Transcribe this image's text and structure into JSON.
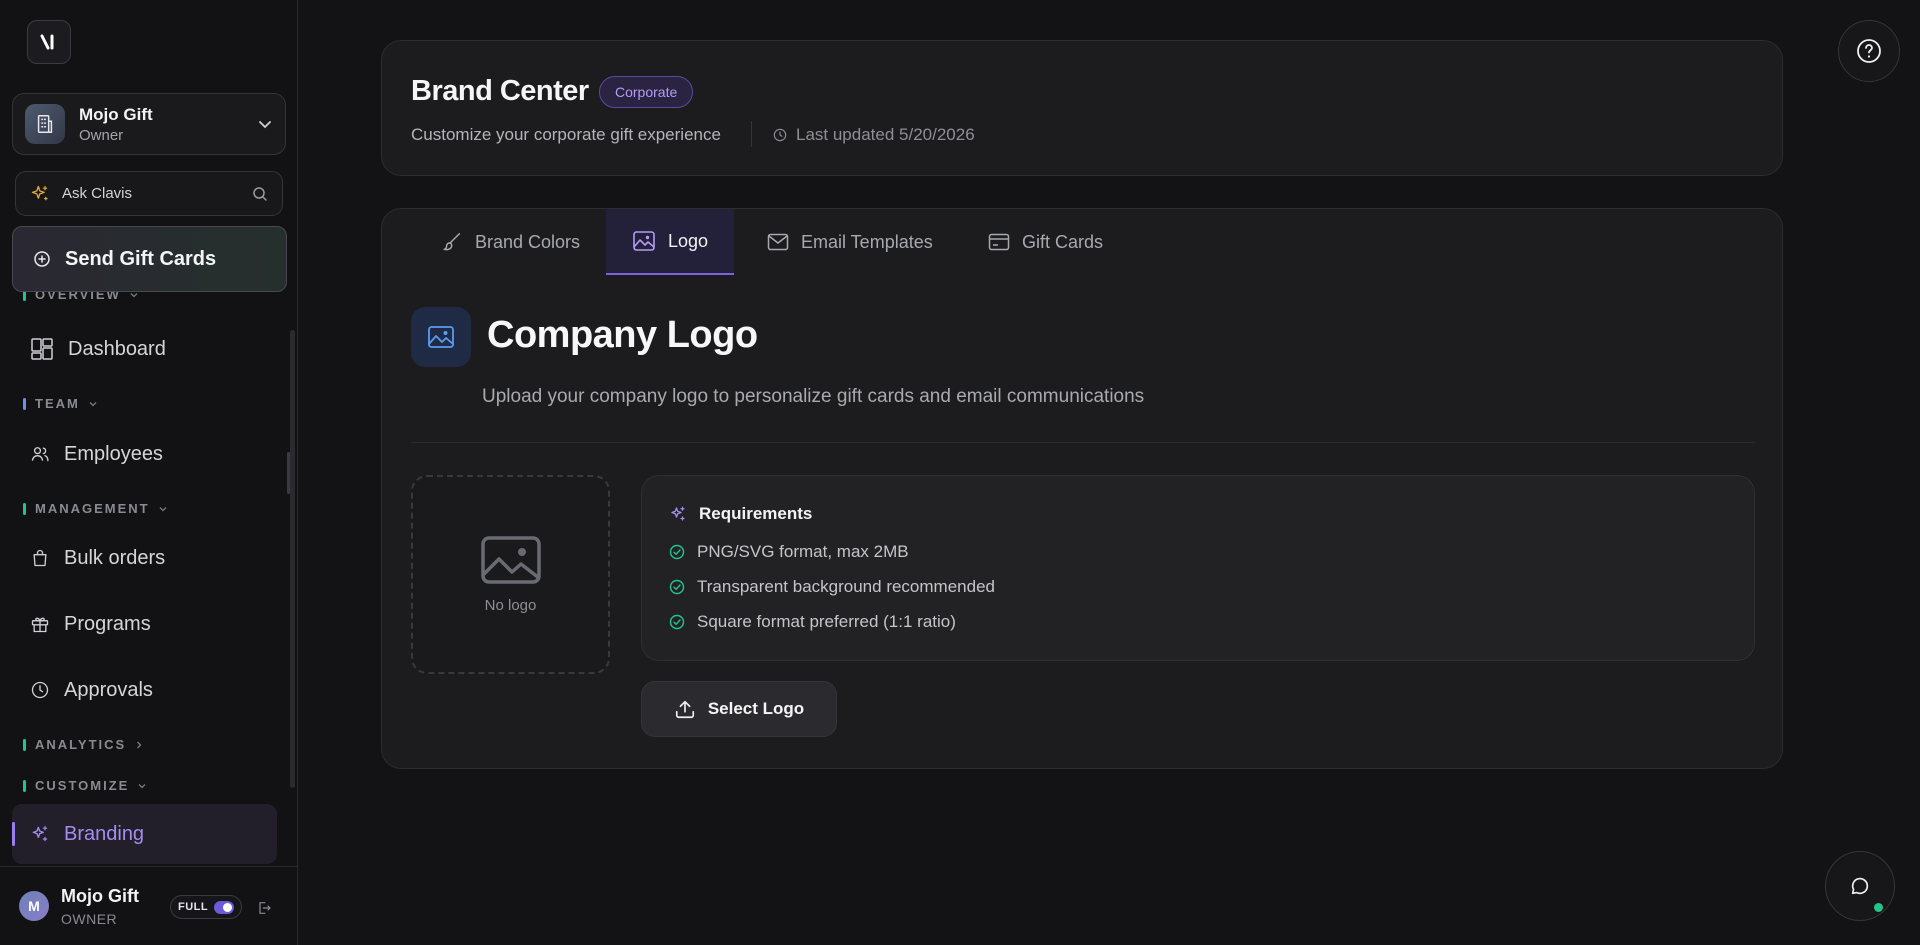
{
  "sidebar": {
    "org": {
      "name": "Mojo Gift",
      "role": "Owner"
    },
    "ask": {
      "label": "Ask Clavis"
    },
    "send_button": "Send Gift Cards",
    "sections": {
      "overview": "OVERVIEW",
      "team": "TEAM",
      "management": "MANAGEMENT",
      "analytics": "ANALYTICS",
      "customize": "CUSTOMIZE"
    },
    "items": {
      "dashboard": "Dashboard",
      "employees": "Employees",
      "bulk_orders": "Bulk orders",
      "programs": "Programs",
      "approvals": "Approvals",
      "branding": "Branding"
    },
    "user": {
      "initial": "M",
      "name": "Mojo Gift",
      "role": "OWNER",
      "mode": "FULL"
    }
  },
  "header": {
    "title": "Brand Center",
    "badge": "Corporate",
    "subtitle": "Customize your corporate gift experience",
    "updated": "Last updated 5/20/2026"
  },
  "tabs": [
    "Brand Colors",
    "Logo",
    "Email Templates",
    "Gift Cards"
  ],
  "active_tab": "Logo",
  "logo_section": {
    "title": "Company Logo",
    "description": "Upload your company logo to personalize gift cards and email communications",
    "placeholder": "No logo",
    "requirements_title": "Requirements",
    "requirements": [
      "PNG/SVG format, max 2MB",
      "Transparent background recommended",
      "Square format preferred (1:1 ratio)"
    ],
    "select_button": "Select Logo"
  },
  "colors": {
    "accent": "#9b7ef0",
    "success": "#22c58b",
    "background": "#131315",
    "card": "#1c1c1f"
  }
}
